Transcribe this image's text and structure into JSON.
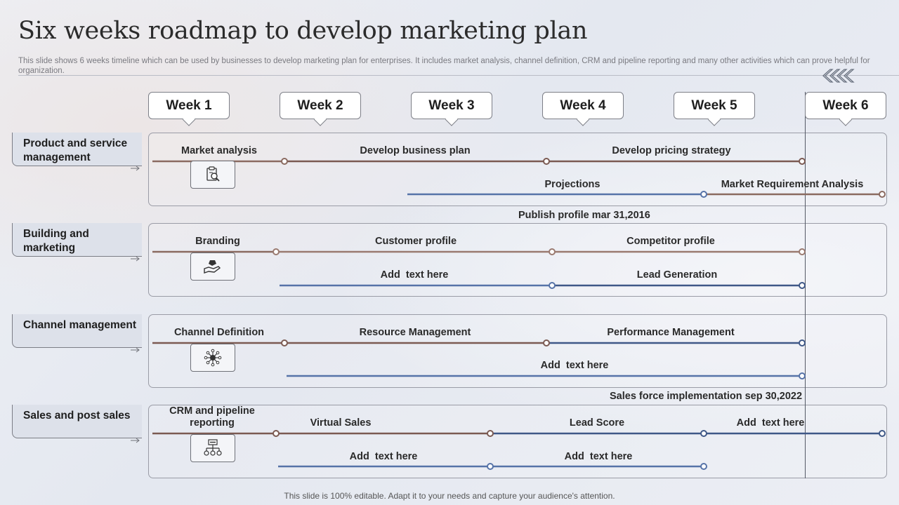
{
  "header": {
    "title": "Six weeks roadmap to develop marketing plan",
    "subtitle": "This slide shows 6 weeks timeline which can be used by businesses to develop marketing plan for enterprises. It includes market analysis, channel definition, CRM and pipeline reporting and many other activities which can prove helpful for organization."
  },
  "weeks": [
    "Week 1",
    "Week 2",
    "Week 3",
    "Week 4",
    "Week 5",
    "Week 6"
  ],
  "colors": {
    "brown": "#8a6a60",
    "blue": "#5673a8",
    "navy": "#3f5887"
  },
  "rows": [
    {
      "label": "Product and service management",
      "icon": "clipboard-search-icon",
      "tasks": [
        "Market analysis",
        "Develop business plan",
        "Develop pricing strategy",
        "Projections",
        "Market Requirement Analysis"
      ],
      "note": "Publish profile mar 31,2016"
    },
    {
      "label": "Building and marketing",
      "icon": "hand-money-icon",
      "tasks": [
        "Branding",
        "Customer profile",
        "Competitor profile",
        "Add  text here",
        "Lead Generation"
      ]
    },
    {
      "label": "Channel management",
      "icon": "network-hub-icon",
      "tasks": [
        "Channel Definition",
        "Resource Management",
        "Performance Management",
        "Add  text here"
      ],
      "note": "Sales force implementation sep 30,2022"
    },
    {
      "label": "Sales and post sales",
      "icon": "crm-org-chart-icon",
      "tasks": [
        "CRM and pipeline reporting",
        "Virtual Sales",
        "Lead Score",
        "Add  text here",
        "Add  text here",
        "Add  text here"
      ]
    }
  ],
  "footer": "This slide is 100% editable. Adapt it to your needs and capture your audience's attention."
}
